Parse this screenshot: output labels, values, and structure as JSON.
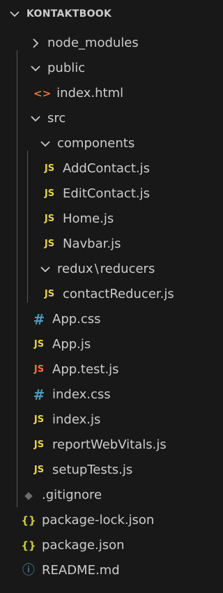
{
  "explorer": {
    "root_label": "KONTAKTBOOK",
    "items": [
      {
        "label": "node_modules",
        "kind": "folder",
        "expanded": false,
        "icon": "chevron-right-icon"
      },
      {
        "label": "public",
        "kind": "folder",
        "expanded": true,
        "icon": "chevron-down-icon"
      },
      {
        "label": "index.html",
        "kind": "file",
        "icon": "html-file-icon",
        "glyph": "<>"
      },
      {
        "label": "src",
        "kind": "folder",
        "expanded": true,
        "icon": "chevron-down-icon"
      },
      {
        "label": "components",
        "kind": "folder",
        "expanded": true,
        "icon": "chevron-down-icon"
      },
      {
        "label": "AddContact.js",
        "kind": "file",
        "icon": "js-file-icon",
        "glyph": "JS"
      },
      {
        "label": "EditContact.js",
        "kind": "file",
        "icon": "js-file-icon",
        "glyph": "JS"
      },
      {
        "label": "Home.js",
        "kind": "file",
        "icon": "js-file-icon",
        "glyph": "JS"
      },
      {
        "label": "Navbar.js",
        "kind": "file",
        "icon": "js-file-icon",
        "glyph": "JS"
      },
      {
        "label": "redux",
        "label2": "reducers",
        "kind": "folder",
        "expanded": true,
        "icon": "chevron-down-icon",
        "separator": "\\"
      },
      {
        "label": "contactReducer.js",
        "kind": "file",
        "icon": "js-file-icon",
        "glyph": "JS"
      },
      {
        "label": "App.css",
        "kind": "file",
        "icon": "css-file-icon",
        "glyph": "#"
      },
      {
        "label": "App.js",
        "kind": "file",
        "icon": "js-file-icon",
        "glyph": "JS"
      },
      {
        "label": "App.test.js",
        "kind": "file",
        "icon": "js-test-file-icon",
        "glyph": "JS"
      },
      {
        "label": "index.css",
        "kind": "file",
        "icon": "css-file-icon",
        "glyph": "#"
      },
      {
        "label": "index.js",
        "kind": "file",
        "icon": "js-file-icon",
        "glyph": "JS"
      },
      {
        "label": "reportWebVitals.js",
        "kind": "file",
        "icon": "js-file-icon",
        "glyph": "JS"
      },
      {
        "label": "setupTests.js",
        "kind": "file",
        "icon": "js-file-icon",
        "glyph": "JS"
      },
      {
        "label": ".gitignore",
        "kind": "file",
        "icon": "git-file-icon",
        "glyph": "◆"
      },
      {
        "label": "package-lock.json",
        "kind": "file",
        "icon": "json-file-icon",
        "glyph": "{}"
      },
      {
        "label": "package.json",
        "kind": "file",
        "icon": "json-file-icon",
        "glyph": "{}"
      },
      {
        "label": "README.md",
        "kind": "file",
        "icon": "info-file-icon",
        "glyph": "ⓘ"
      }
    ]
  },
  "colors": {
    "background": "#181818",
    "text": "#cccccc",
    "js": "#e8d44d",
    "js_test": "#f0743e",
    "css": "#519aba",
    "html": "#e37933",
    "json": "#cbcb41",
    "indent_guide": "#585858"
  }
}
